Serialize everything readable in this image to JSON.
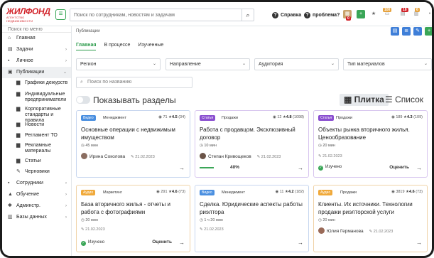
{
  "brand": {
    "logo_main": "ЖИЛФОНД",
    "logo_sub": "АГЕНТСТВО НЕДВИЖИМОСТИ",
    "color": "#d2232a"
  },
  "header": {
    "search_placeholder": "Поиск по сотрудникам, новостям и задачам",
    "help": "Справка",
    "problem": "проблема?",
    "badges": [
      "0",
      "6",
      "100",
      "18",
      "6"
    ]
  },
  "sidebar": {
    "search": "Поиск по меню",
    "items": [
      {
        "label": "Главная",
        "icon": "home-icon"
      },
      {
        "label": "Задачи",
        "icon": "tasks-icon"
      },
      {
        "label": "Личное",
        "icon": "user-icon"
      },
      {
        "label": "Публикации",
        "icon": "publications-icon"
      }
    ],
    "sub": [
      "Графики дежурств",
      "Индивидуальные предприниматели",
      "Корпоративные стандарты и правила",
      "Новости",
      "Регламент ТО",
      "Рекламные материалы",
      "Статьи",
      "Черновики"
    ],
    "bottom": [
      "Сотрудники",
      "Обучение",
      "Админстр.",
      "Базы данных"
    ]
  },
  "main": {
    "breadcrumb": "Публикации",
    "tabs": [
      "Главная",
      "В процессе",
      "Изученные"
    ],
    "filters": [
      "Регион",
      "Направление",
      "Аудитория",
      "Тип материалов"
    ],
    "search_placeholder": "Поиск по названию",
    "show_sections": "Показывать разделы",
    "view_tile": "Плитка",
    "view_list": "Список"
  },
  "cards": [
    {
      "tag": "Видео",
      "tag_color": "#4a8fe0",
      "cat": "Менеджмент",
      "views": "71",
      "rating": "4.5",
      "count": "(34)",
      "title": "Основные операции с недвижимым имуществом",
      "dur": "45 мин",
      "author": "Ирина Соколова",
      "date": "21.02.2023",
      "status": ""
    },
    {
      "tag": "Статья",
      "tag_color": "#8a4fd0",
      "cat": "Продажи",
      "views": "12",
      "rating": "4.8",
      "count": "(1098)",
      "title": "Работа с продавцом. Эксклюзивный договор",
      "dur": "10 мин",
      "author": "Степан Кривощеков",
      "date": "21.02.2023",
      "progress": "40%"
    },
    {
      "tag": "Статья",
      "tag_color": "#8a4fd0",
      "cat": "Продажи",
      "views": "189",
      "rating": "4.3",
      "count": "(109)",
      "title": "Объекты рынка вторичного жилья. Ценообразование",
      "dur": "20 мин",
      "author": "",
      "date": "21.02.2023",
      "status": "Изучено",
      "rate": "Оценить"
    },
    {
      "tag": "Аудио",
      "tag_color": "#f0a93a",
      "cat": "Маркетинг",
      "views": "291",
      "rating": "4.6",
      "count": "(73)",
      "title": "База вторичного жилья - отчеты и работа с фотографиями",
      "dur": "20 мин",
      "author": "",
      "date": "21.02.2023",
      "status": "Изучено",
      "rate": "Оценить"
    },
    {
      "tag": "Видео",
      "tag_color": "#4a8fe0",
      "cat": "Менеджмент",
      "views": "11",
      "rating": "4.2",
      "count": "(182)",
      "title": "Сделка. Юридические аспекты работы риэлтора",
      "dur": "1 ч 20 мин",
      "author": "",
      "date": "21.02.2023",
      "status": ""
    },
    {
      "tag": "Аудио",
      "tag_color": "#f0a93a",
      "cat": "Продажи",
      "views": "3819",
      "rating": "4.6",
      "count": "(73)",
      "title": "Клиенты. Их источники. Технологии продажи риэлторской услуги",
      "dur": "20 мин",
      "author": "Юлия Германова",
      "date": "21.02.2023",
      "status": ""
    }
  ]
}
